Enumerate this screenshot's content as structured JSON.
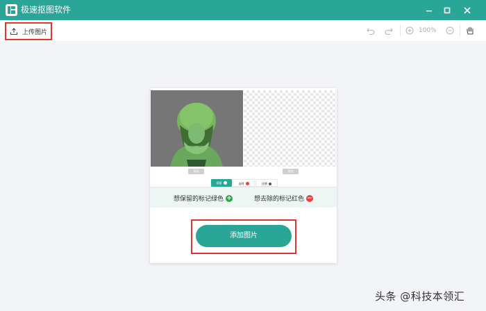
{
  "window": {
    "title": "极速抠图软件"
  },
  "toolbar": {
    "upload_label": "上传图片",
    "zoom": "100%"
  },
  "editor": {
    "left_tag": "原图",
    "right_tag": "预览",
    "pill_keep": "保留",
    "pill_remove": "去除",
    "pill_restore": "还原",
    "hint_keep": "想保留的标记绿色",
    "hint_remove": "想去除的标记红色",
    "add_image": "添加图片"
  },
  "colors": {
    "accent": "#2aa698",
    "highlight": "#e2342b",
    "keep": "#2fa64a",
    "remove": "#e8423b"
  },
  "watermark": "头条 @科技本领汇"
}
